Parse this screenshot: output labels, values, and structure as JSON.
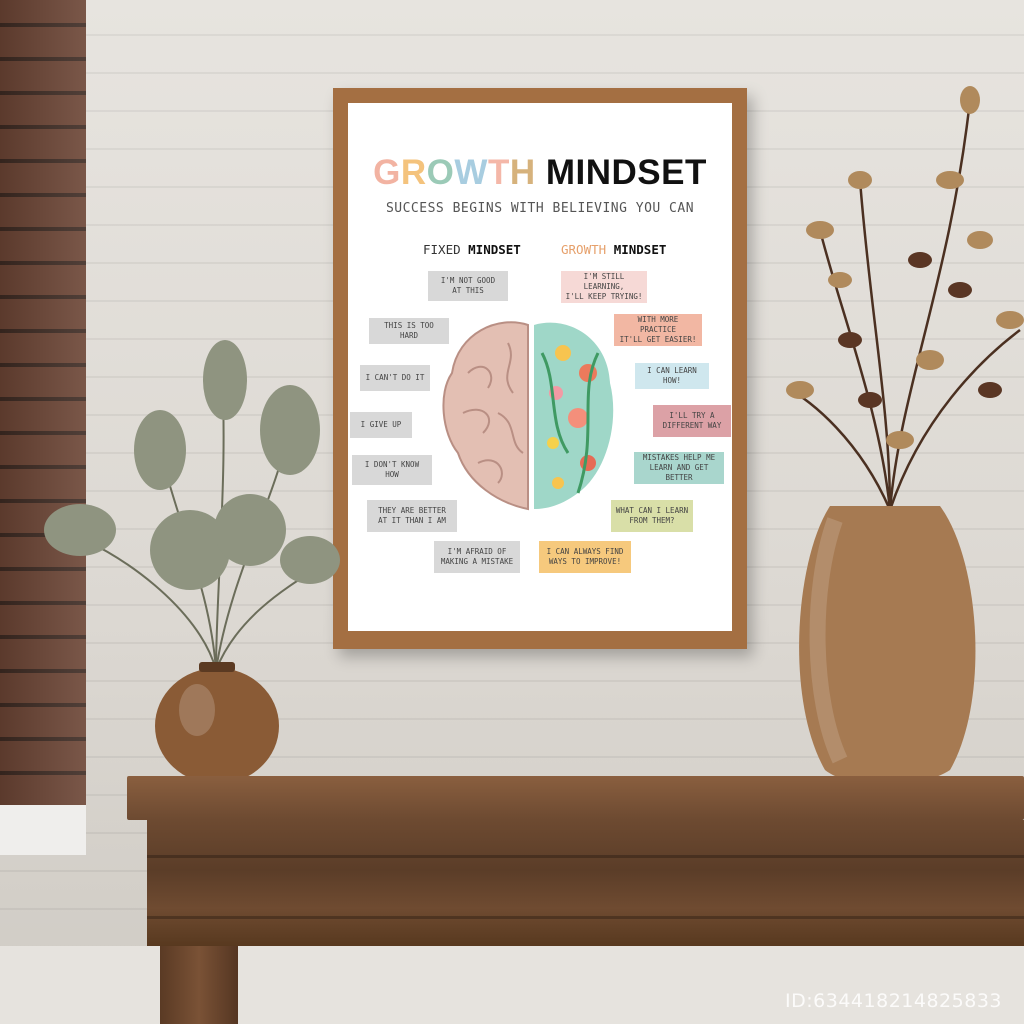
{
  "poster": {
    "title_parts": [
      {
        "text": "G"
      },
      {
        "text": "R"
      },
      {
        "text": "O"
      },
      {
        "text": "W"
      },
      {
        "text": "T"
      },
      {
        "text": "H"
      }
    ],
    "title_rest": " MINDSET",
    "subtitle": "SUCCESS BEGINS WITH BELIEVING YOU CAN",
    "fixed_header_a": "FIXED ",
    "fixed_header_b": "MINDSET",
    "growth_header_a": "GROWTH ",
    "growth_header_b": "MINDSET",
    "fixed_notes": [
      "I'M NOT GOOD\nAT THIS",
      "THIS IS TOO HARD",
      "I CAN'T DO IT",
      "I GIVE UP",
      "I DON'T KNOW HOW",
      "THEY ARE BETTER\nAT IT THAN I AM",
      "I'M AFRAID OF\nMAKING A MISTAKE"
    ],
    "growth_notes": [
      {
        "text": "I'M STILL LEARNING,\nI'LL KEEP TRYING!",
        "color": "#f6d9d6"
      },
      {
        "text": "WITH MORE PRACTICE\nIT'LL GET EASIER!",
        "color": "#f2b7a3"
      },
      {
        "text": "I CAN LEARN HOW!",
        "color": "#cfe7ee"
      },
      {
        "text": "I'LL TRY A\nDIFFERENT WAY",
        "color": "#dca1a6"
      },
      {
        "text": "MISTAKES HELP ME\nLEARN AND GET BETTER",
        "color": "#a9d6cd"
      },
      {
        "text": "WHAT CAN I LEARN\nFROM THEM?",
        "color": "#d9dfa8"
      },
      {
        "text": "I CAN ALWAYS FIND\nWAYS TO IMPROVE!",
        "color": "#f6c97d"
      }
    ]
  },
  "watermark": "ID:634418214825833",
  "colors": {
    "frame": "#a46f42",
    "shelf": "#6d4a31",
    "vase_large": "#a67a52",
    "vase_small": "#8a5b36"
  }
}
